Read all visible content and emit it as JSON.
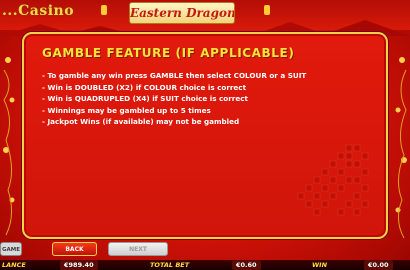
{
  "header": {
    "left_logo": "...Casino",
    "game_title": "Eastern Dragon"
  },
  "panel": {
    "title": "GAMBLE FEATURE (IF APPLICABLE)",
    "rules": [
      "- To gamble any win press GAMBLE then select COLOUR or a SUIT",
      "- Win is DOUBLED (X2) if COLOUR choice is correct",
      "- Win is QUADRUPLED (X4) if SUIT choice is correct",
      "- Winnings may be gambled up to 5 times",
      "- Jackpot Wins (if available) may not be gambled"
    ]
  },
  "buttons": {
    "left": "GAME",
    "back": "BACK",
    "next": "NEXT"
  },
  "status": {
    "balance_label": "LANCE",
    "balance_value": "€989.40",
    "total_bet_label": "TOTAL BET",
    "total_bet_value": "€0.60",
    "win_label": "WIN",
    "win_value": "€0.00"
  },
  "colors": {
    "panel_red": "#d0150a",
    "gold": "#ffd24a",
    "title_yellow": "#ffe23a"
  }
}
